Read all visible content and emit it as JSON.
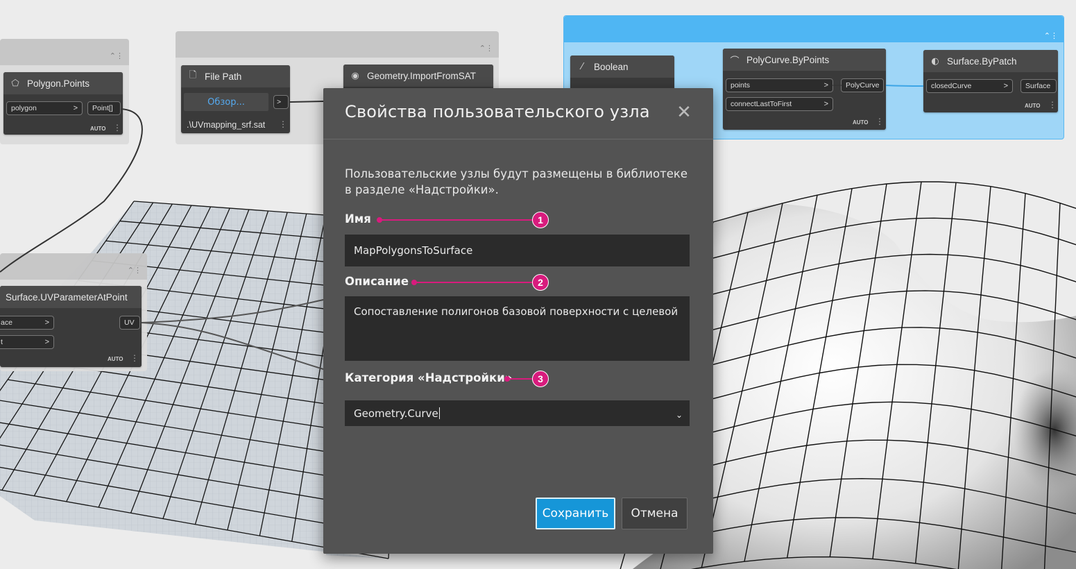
{
  "nodes": {
    "polygon_points": {
      "title": "Polygon.Points",
      "input": "polygon",
      "output": "Point[]",
      "lacing": "AUTO"
    },
    "file_path": {
      "title": "File Path",
      "browse": "Обзор...",
      "value": ".\\UVmapping_srf.sat"
    },
    "import_sat": {
      "title": "Geometry.ImportFromSAT"
    },
    "uv_param": {
      "title": "Surface.UVParameterAtPoint",
      "input1": "ace",
      "input2": "t",
      "output": "UV",
      "lacing": "AUTO"
    },
    "boolean": {
      "title": "Boolean"
    },
    "polycurve": {
      "title": "PolyCurve.ByPoints",
      "input1": "points",
      "input2": "connectLastToFirst",
      "output": "PolyCurve",
      "lacing": "AUTO"
    },
    "surface_bypatch": {
      "title": "Surface.ByPatch",
      "input": "closedCurve",
      "output": "Surface",
      "lacing": "AUTO"
    }
  },
  "dialog": {
    "title": "Свойства пользовательского узла",
    "description": "Пользовательские узлы будут размещены в библиотеке в разделе «Надстройки».",
    "name_label": "Имя",
    "name_value": "MapPolygonsToSurface",
    "desc_label": "Описание",
    "desc_value": "Сопоставление полигонов базовой поверхности с целевой",
    "category_label": "Категория «Надстройки»",
    "category_value": "Geometry.Curve",
    "save_label": "Сохранить",
    "cancel_label": "Отмена"
  },
  "annotations": {
    "one": "1",
    "two": "2",
    "three": "3"
  },
  "colors": {
    "accent": "#1696d8",
    "annotation": "#d81b7d",
    "group_blue": "#4fb6f3",
    "dialog_bg": "#535353"
  }
}
